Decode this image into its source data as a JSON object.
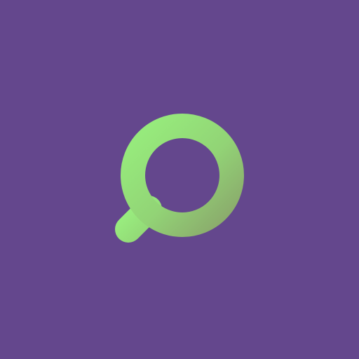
{
  "background": {
    "color": "#64478d"
  },
  "icon": {
    "name": "search-icon",
    "gradient_light": "#97ee7d",
    "gradient_dark": "#8aa66b"
  }
}
